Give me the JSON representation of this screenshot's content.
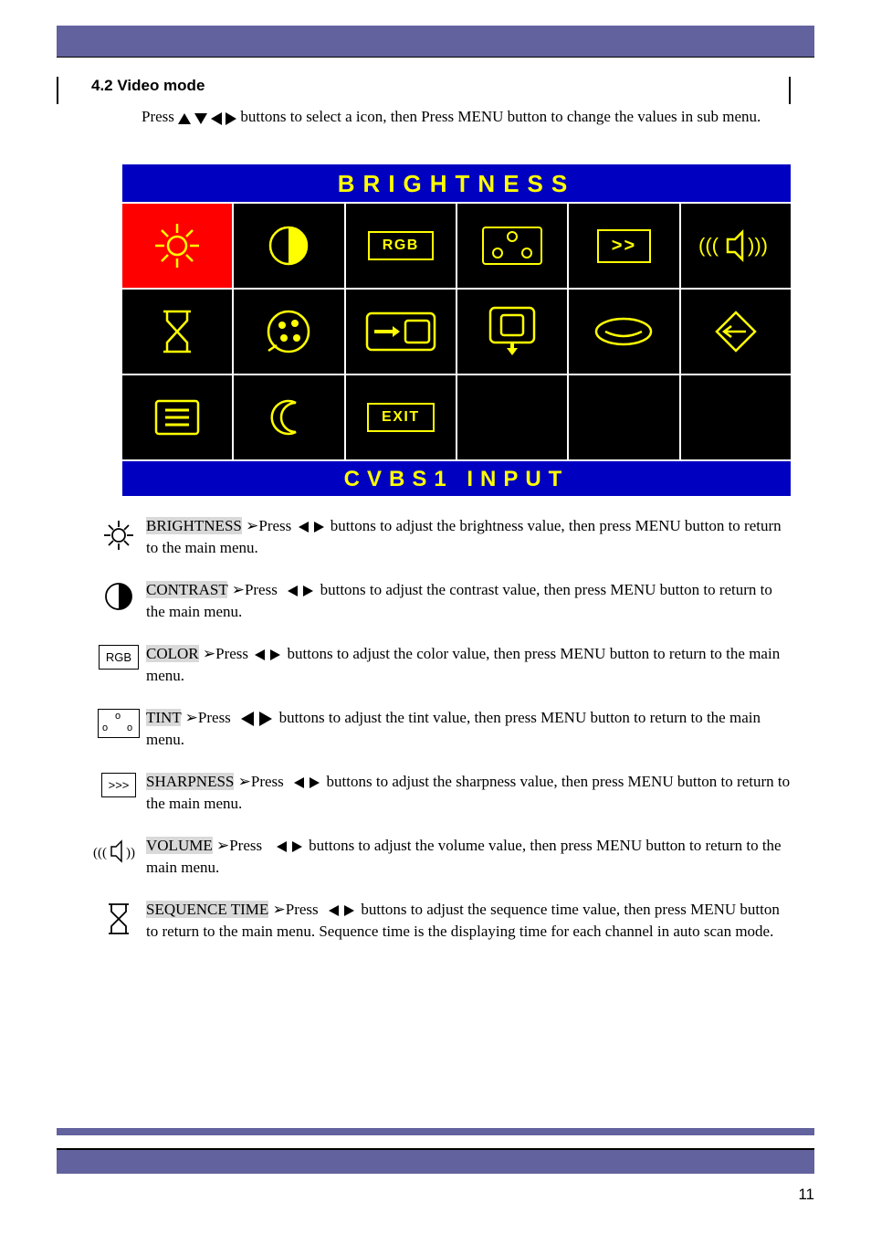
{
  "heading": "4.2  Video mode",
  "intro_prefix": "Press ",
  "intro_suffix": "       buttons to select a icon, then Press MENU button to change the values in sub menu.",
  "osd": {
    "title": "BRIGHTNESS",
    "rgb_label": "RGB",
    "sharp_icon": ">>",
    "exit_label": "EXIT",
    "footer": "CVBS1    INPUT"
  },
  "descriptions": {
    "brightness": {
      "label": "BRIGHTNESS",
      "press": "Press",
      "text1": "       buttons to adjust the brightness value, then press MENU button to return to the main menu."
    },
    "contrast": {
      "label": "CONTRAST",
      "press": "Press",
      "text1": "     buttons to adjust the contrast value, then press MENU button to return to the main menu."
    },
    "color": {
      "label": "COLOR",
      "press": "Press",
      "text1": "      buttons to adjust the color value, then press MENU button to return to the main menu."
    },
    "tint": {
      "label": "TINT",
      "press": "Press",
      "text1": "       buttons to adjust the tint value, then press MENU button to return to the main menu."
    },
    "sharpness": {
      "label": "SHARPNESS",
      "press": "Press",
      "text1": "     buttons to adjust the sharpness value, then press MENU button to return to the main menu."
    },
    "volume": {
      "label": "VOLUME",
      "press": "Press",
      "text1": "      buttons to adjust the volume value, then press MENU button to return to the main menu."
    },
    "seqtime": {
      "label": "SEQUENCE TIME",
      "press": "Press",
      "text1": "      buttons to adjust the sequence time value, then press MENU button to return to the main menu. Sequence time is the displaying time for each channel in auto scan mode."
    }
  },
  "icons": {
    "rgb_box": "RGB",
    "sharp_box": ">>>"
  },
  "page_number": "11"
}
